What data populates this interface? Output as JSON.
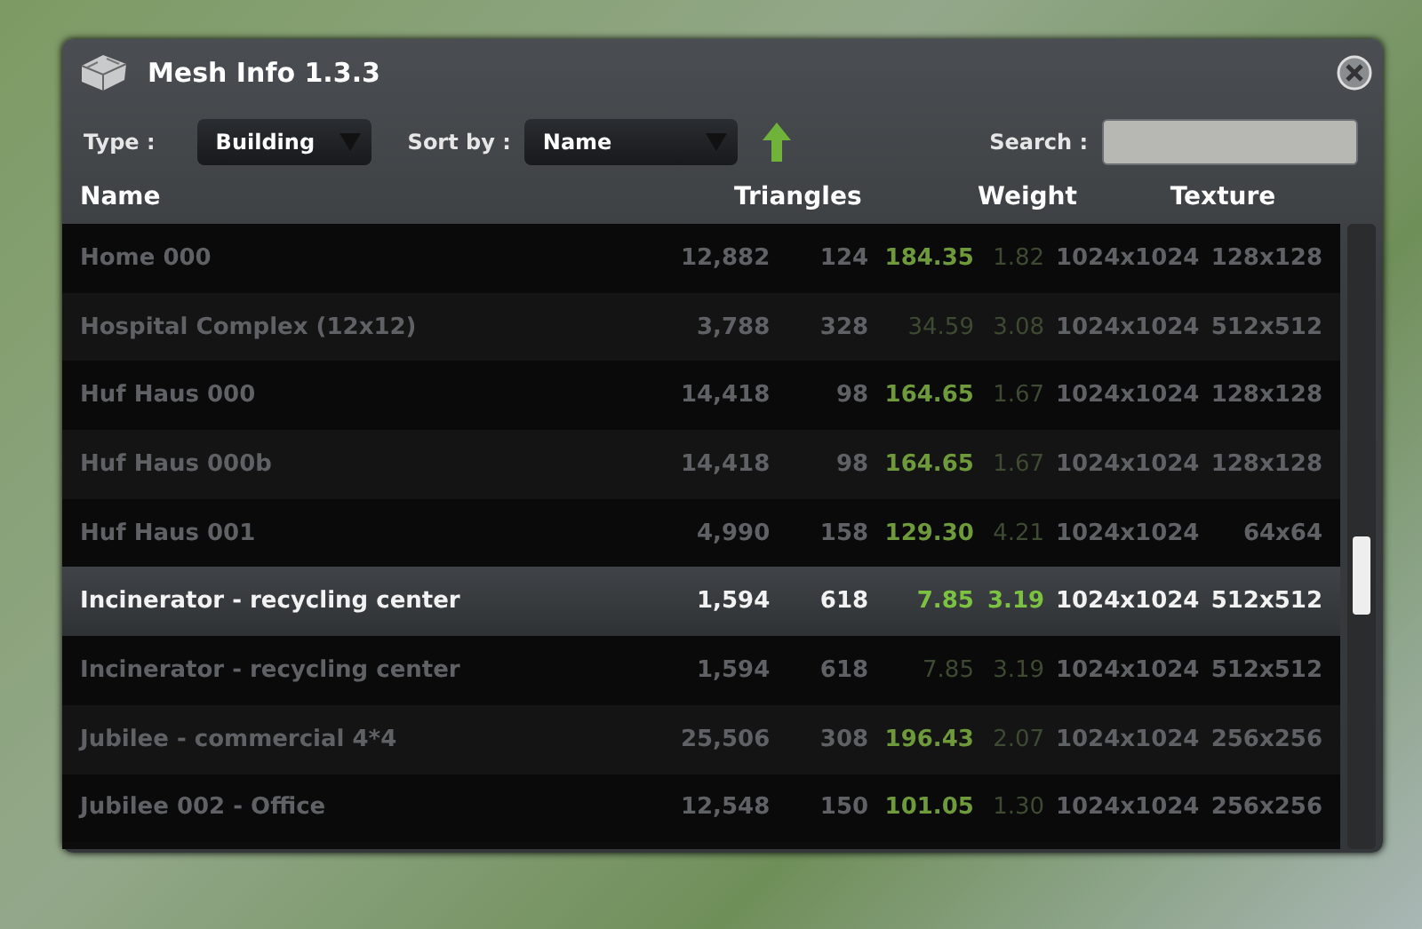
{
  "window": {
    "title": "Mesh Info 1.3.3"
  },
  "filters": {
    "type_label": "Type :",
    "type_value": "Building",
    "sort_label": "Sort by :",
    "sort_value": "Name",
    "search_label": "Search :"
  },
  "table": {
    "columns": [
      "Name",
      "Triangles",
      "Weight",
      "Texture"
    ],
    "rows": [
      {
        "name": "Home 000",
        "triangles": "12,882",
        "column_3": "124",
        "weight": "184.35",
        "weight_2": "1.82",
        "texture": "1024x1024",
        "texture_2": "128x128",
        "selected": false,
        "weight_low": false
      },
      {
        "name": "Hospital Complex (12x12)",
        "triangles": "3,788",
        "column_3": "328",
        "weight": "34.59",
        "weight_2": "3.08",
        "texture": "1024x1024",
        "texture_2": "512x512",
        "selected": false,
        "weight_low": true
      },
      {
        "name": "Huf Haus 000",
        "triangles": "14,418",
        "column_3": "98",
        "weight": "164.65",
        "weight_2": "1.67",
        "texture": "1024x1024",
        "texture_2": "128x128",
        "selected": false,
        "weight_low": false
      },
      {
        "name": "Huf Haus 000b",
        "triangles": "14,418",
        "column_3": "98",
        "weight": "164.65",
        "weight_2": "1.67",
        "texture": "1024x1024",
        "texture_2": "128x128",
        "selected": false,
        "weight_low": false
      },
      {
        "name": "Huf Haus 001",
        "triangles": "4,990",
        "column_3": "158",
        "weight": "129.30",
        "weight_2": "4.21",
        "texture": "1024x1024",
        "texture_2": "64x64",
        "selected": false,
        "weight_low": false
      },
      {
        "name": "Incinerator - recycling center",
        "triangles": "1,594",
        "column_3": "618",
        "weight": "7.85",
        "weight_2": "3.19",
        "texture": "1024x1024",
        "texture_2": "512x512",
        "selected": true,
        "weight_low": false
      },
      {
        "name": "Incinerator - recycling center",
        "triangles": "1,594",
        "column_3": "618",
        "weight": "7.85",
        "weight_2": "3.19",
        "texture": "1024x1024",
        "texture_2": "512x512",
        "selected": false,
        "weight_low": true
      },
      {
        "name": "Jubilee - commercial 4*4",
        "triangles": "25,506",
        "column_3": "308",
        "weight": "196.43",
        "weight_2": "2.07",
        "texture": "1024x1024",
        "texture_2": "256x256",
        "selected": false,
        "weight_low": false
      },
      {
        "name": "Jubilee 002 - Office",
        "triangles": "12,548",
        "column_3": "150",
        "weight": "101.05",
        "weight_2": "1.30",
        "texture": "1024x1024",
        "texture_2": "256x256",
        "selected": false,
        "weight_low": false
      }
    ]
  }
}
